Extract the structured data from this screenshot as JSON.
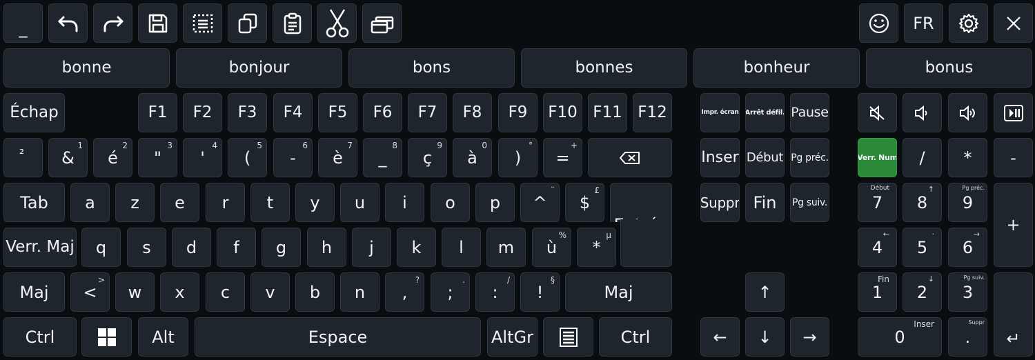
{
  "toolbar": {
    "minimize": "_",
    "language": "FR",
    "icons": [
      "undo-icon",
      "redo-icon",
      "save-icon",
      "select-all-icon",
      "copy-icon",
      "paste-icon",
      "cut-icon",
      "windows-icon",
      "emoji-icon",
      "settings-icon",
      "close-icon"
    ]
  },
  "suggestions": [
    "bonne",
    "bonjour",
    "bons",
    "bonnes",
    "bonheur",
    "bonus"
  ],
  "frow": {
    "esc": "Échap",
    "fkeys": [
      "F1",
      "F2",
      "F3",
      "F4",
      "F5",
      "F6",
      "F7",
      "F8",
      "F9",
      "F10",
      "F11",
      "F12"
    ],
    "prtsc": "Impr. écran",
    "scroll": "Arrêt défil.",
    "pause": "Pause"
  },
  "row1": {
    "keys": [
      {
        "m": "²",
        "s": ""
      },
      {
        "m": "&",
        "s": "1"
      },
      {
        "m": "é",
        "s": "2"
      },
      {
        "m": "\"",
        "s": "3"
      },
      {
        "m": "'",
        "s": "4"
      },
      {
        "m": "(",
        "s": "5"
      },
      {
        "m": "-",
        "s": "6"
      },
      {
        "m": "è",
        "s": "7"
      },
      {
        "m": "_",
        "s": "8"
      },
      {
        "m": "ç",
        "s": "9"
      },
      {
        "m": "à",
        "s": "0"
      },
      {
        "m": ")",
        "s": "°"
      },
      {
        "m": "=",
        "s": "+"
      }
    ],
    "backspace": "⌫"
  },
  "row2": {
    "tab": "Tab",
    "keys": [
      {
        "m": "a",
        "s": ""
      },
      {
        "m": "z",
        "s": ""
      },
      {
        "m": "e",
        "s": ""
      },
      {
        "m": "r",
        "s": ""
      },
      {
        "m": "t",
        "s": ""
      },
      {
        "m": "y",
        "s": ""
      },
      {
        "m": "u",
        "s": ""
      },
      {
        "m": "i",
        "s": ""
      },
      {
        "m": "o",
        "s": ""
      },
      {
        "m": "p",
        "s": ""
      },
      {
        "m": "^",
        "s": "¨"
      },
      {
        "m": "$",
        "s": "£"
      }
    ],
    "enter": "Entrée"
  },
  "row3": {
    "caps": "Verr. Maj",
    "keys": [
      {
        "m": "q",
        "s": ""
      },
      {
        "m": "s",
        "s": ""
      },
      {
        "m": "d",
        "s": ""
      },
      {
        "m": "f",
        "s": ""
      },
      {
        "m": "g",
        "s": ""
      },
      {
        "m": "h",
        "s": ""
      },
      {
        "m": "j",
        "s": ""
      },
      {
        "m": "k",
        "s": ""
      },
      {
        "m": "l",
        "s": ""
      },
      {
        "m": "m",
        "s": ""
      },
      {
        "m": "ù",
        "s": "%"
      },
      {
        "m": "*",
        "s": "µ"
      }
    ]
  },
  "row4": {
    "shift": "Maj",
    "keys": [
      {
        "m": "<",
        "s": ">"
      },
      {
        "m": "w",
        "s": ""
      },
      {
        "m": "x",
        "s": ""
      },
      {
        "m": "c",
        "s": ""
      },
      {
        "m": "v",
        "s": ""
      },
      {
        "m": "b",
        "s": ""
      },
      {
        "m": "n",
        "s": ""
      },
      {
        "m": ",",
        "s": "?"
      },
      {
        "m": ";",
        "s": "."
      },
      {
        "m": ":",
        "s": "/"
      },
      {
        "m": "!",
        "s": "§"
      }
    ],
    "rshift": "Maj"
  },
  "row5": {
    "ctrl": "Ctrl",
    "alt": "Alt",
    "space": "Espace",
    "altgr": "AltGr",
    "rctrl": "Ctrl"
  },
  "nav": {
    "insert": "Inser",
    "home": "Début",
    "pgup": "Pg préc.",
    "delete": "Suppr",
    "end": "Fin",
    "pgdn": "Pg suiv.",
    "up": "↑",
    "left": "←",
    "down": "↓",
    "right": "→"
  },
  "numpad": {
    "numlock": "Verr. Num",
    "div": "/",
    "mul": "*",
    "sub": "-",
    "add": "+",
    "enter": "↵",
    "n7": "7",
    "n7s": "Début",
    "n8": "8",
    "n8s": "↑",
    "n9": "9",
    "n9s": "Pg préc.",
    "n4": "4",
    "n4s": "←",
    "n5": "5",
    "n5s": "·",
    "n6": "6",
    "n6s": "→",
    "n1": "1",
    "n1s": "Fin",
    "n2": "2",
    "n2s": "↓",
    "n3": "3",
    "n3s": "Pg suiv.",
    "n0": "0",
    "n0s": "Inser",
    "dot": ".",
    "dots": "Suppr"
  },
  "colors": {
    "background": "#0a0d10",
    "key": "#1f252c",
    "numlock_active": "#2a8a3a"
  }
}
